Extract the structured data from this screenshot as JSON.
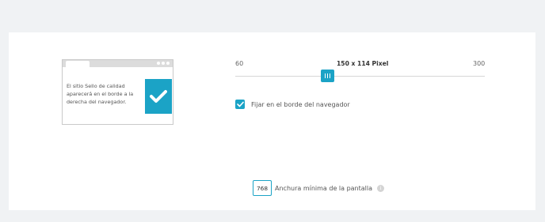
{
  "preview": {
    "text": "El sitio Sello de calidad aparecerá en el borde a la derecha del navegador."
  },
  "slider": {
    "min_label": "60",
    "max_label": "300",
    "value_label": "150 x 114 Pixel",
    "value": 150,
    "min": 60,
    "max": 300
  },
  "checkbox": {
    "label": "Fijar en el borde del navegador",
    "checked": true
  },
  "min_width": {
    "value": "768",
    "label": "Anchura mínima de la pantalla",
    "info_icon": "info-icon"
  },
  "colors": {
    "accent": "#1ba3c6",
    "background": "#f0f2f4",
    "panel": "#ffffff"
  }
}
